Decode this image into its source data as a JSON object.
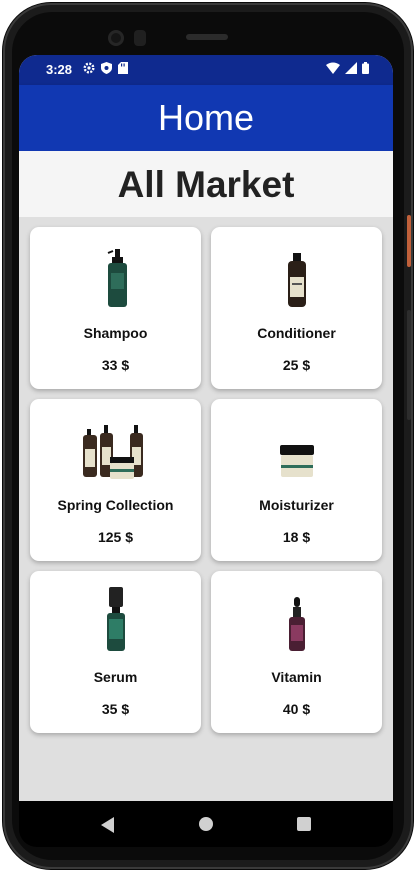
{
  "status_bar": {
    "time": "3:28",
    "icons_left": [
      "gear-icon",
      "shield-icon",
      "sd-card-icon"
    ],
    "icons_right": [
      "wifi-icon",
      "signal-icon",
      "battery-icon"
    ]
  },
  "app_bar": {
    "title": "Home"
  },
  "section": {
    "title": "All Market"
  },
  "products": [
    {
      "name": "Shampoo",
      "price": "33 $",
      "image": "shampoo-bottle-image"
    },
    {
      "name": "Conditioner",
      "price": "25 $",
      "image": "conditioner-bottle-image"
    },
    {
      "name": "Spring Collection",
      "price": "125 $",
      "image": "collection-set-image"
    },
    {
      "name": "Moisturizer",
      "price": "18 $",
      "image": "moisturizer-jar-image"
    },
    {
      "name": "Serum",
      "price": "35 $",
      "image": "serum-bottle-image"
    },
    {
      "name": "Vitamin",
      "price": "40 $",
      "image": "vitamin-dropper-image"
    }
  ],
  "colors": {
    "status_bar": "#0f2a8f",
    "app_bar": "#1138b2",
    "background": "#dfdfdf",
    "card": "#ffffff"
  },
  "nav_bar": {
    "icons": [
      "back-icon",
      "home-icon",
      "recents-icon"
    ]
  }
}
